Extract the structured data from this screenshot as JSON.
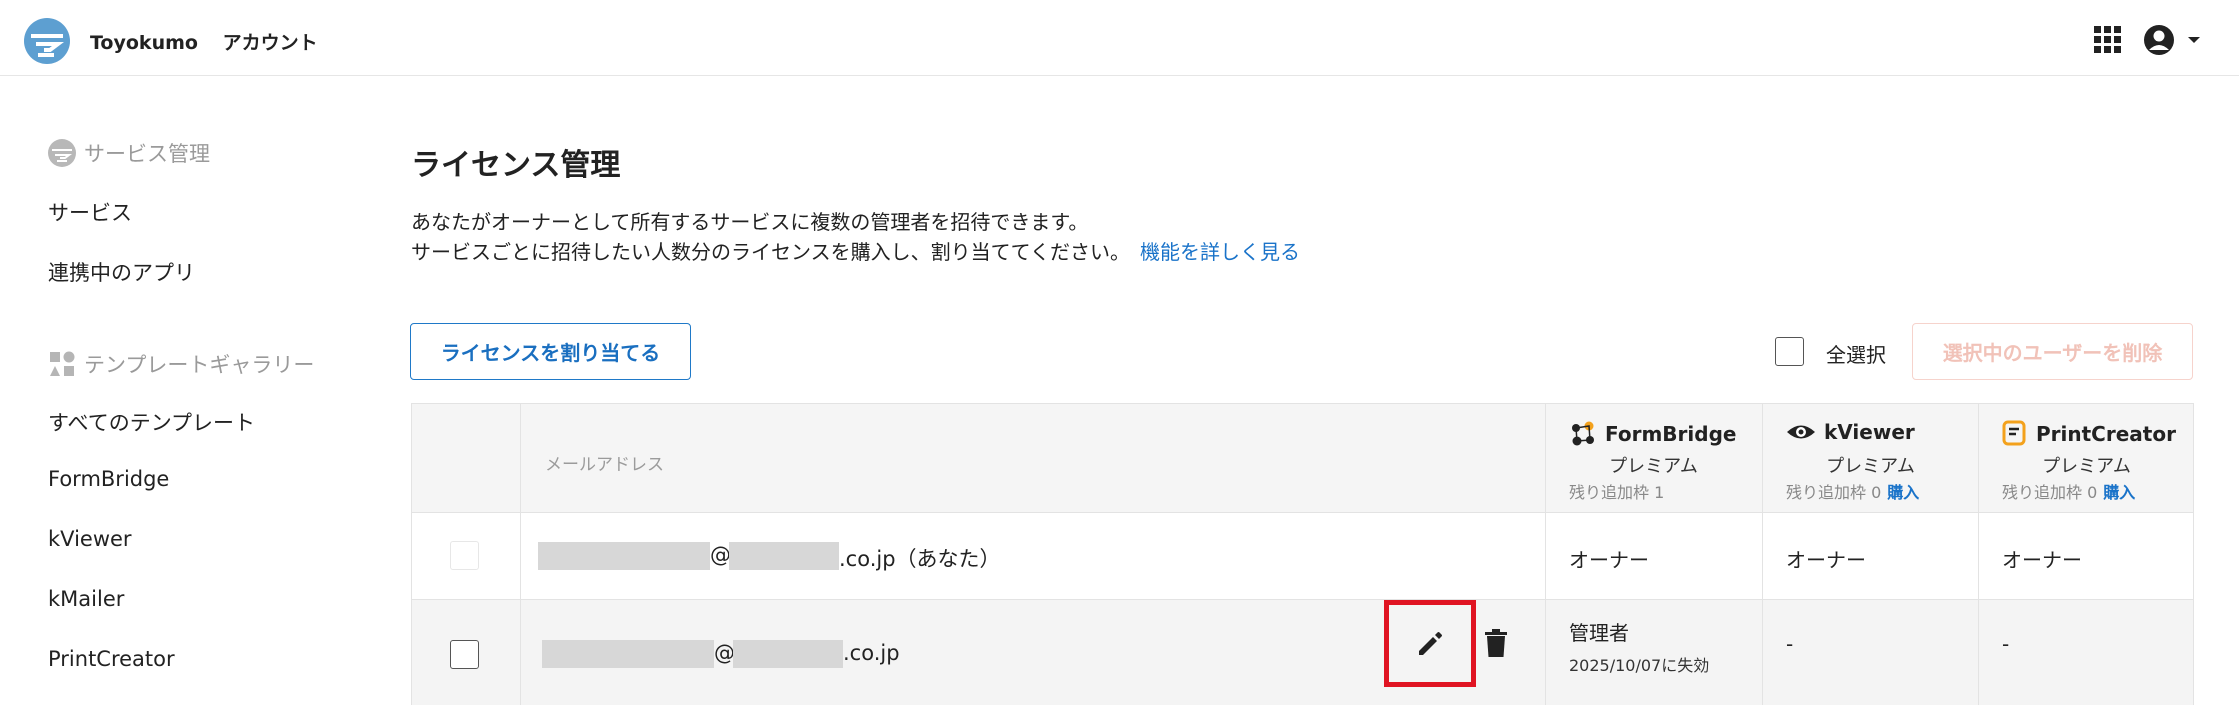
{
  "header": {
    "brand": "Toyokumo",
    "account": "アカウント"
  },
  "sidebar": {
    "service_section": "サービス管理",
    "service_items": [
      "サービス",
      "連携中のアプリ"
    ],
    "template_section": "テンプレートギャラリー",
    "template_items": [
      "すべてのテンプレート",
      "FormBridge",
      "kViewer",
      "kMailer",
      "PrintCreator"
    ]
  },
  "main": {
    "title": "ライセンス管理",
    "desc_line1": "あなたがオーナーとして所有するサービスに複数の管理者を招待できます。",
    "desc_line2": "サービスごとに招待したい人数分のライセンスを購入し、割り当ててください。",
    "learn_more": "機能を詳しく見る",
    "assign_button": "ライセンスを割り当てる",
    "select_all": "全選択",
    "delete_selected": "選択中のユーザーを削除"
  },
  "table": {
    "email_header": "メールアドレス",
    "services": [
      {
        "name": "FormBridge",
        "plan": "プレミアム",
        "remaining": "残り追加枠 1",
        "buy": ""
      },
      {
        "name": "kViewer",
        "plan": "プレミアム",
        "remaining": "残り追加枠 0",
        "buy": "購入"
      },
      {
        "name": "PrintCreator",
        "plan": "プレミアム",
        "remaining": "残り追加枠 0",
        "buy": "購入"
      }
    ],
    "rows": [
      {
        "at": "@",
        "domain_suffix": ".co.jp（あなた）",
        "roles": [
          "オーナー",
          "オーナー",
          "オーナー"
        ]
      },
      {
        "at": "@",
        "domain_suffix": ".co.jp",
        "role": "管理者",
        "expires": "2025/10/07に失効",
        "roles_other": [
          "-",
          "-"
        ]
      }
    ]
  },
  "colors": {
    "accent": "#1a73c9",
    "highlight": "#e01422",
    "delete_disabled": "#f1c2b8"
  },
  "icons": [
    "toyokumo-logo-icon",
    "apps-grid-icon",
    "account-circle-icon",
    "chevron-down-icon",
    "service-icon",
    "template-icon",
    "formbridge-icon",
    "kviewer-icon",
    "printcreator-icon",
    "pencil-icon",
    "trash-icon"
  ]
}
